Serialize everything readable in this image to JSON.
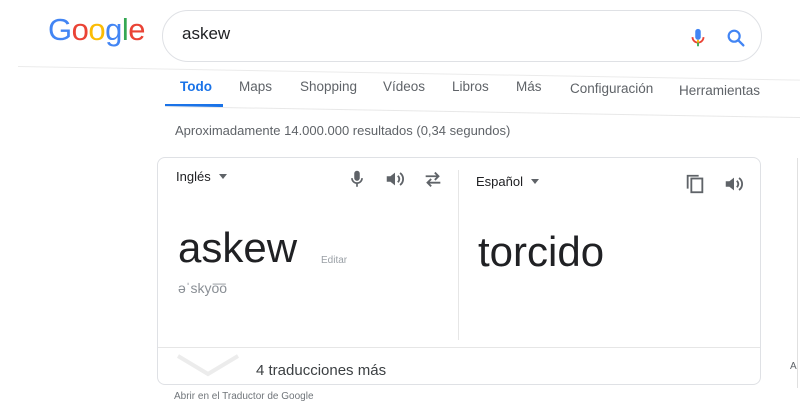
{
  "logo": {
    "letters": [
      "G",
      "o",
      "o",
      "g",
      "l",
      "e"
    ],
    "colors": [
      "#4285f4",
      "#ea4335",
      "#fbbc05",
      "#4285f4",
      "#34a853",
      "#ea4335"
    ]
  },
  "search": {
    "query": "askew"
  },
  "tabs": [
    {
      "label": "Todo",
      "active": true
    },
    {
      "label": "Maps"
    },
    {
      "label": "Shopping"
    },
    {
      "label": "Vídeos"
    },
    {
      "label": "Libros"
    },
    {
      "label": "Más"
    },
    {
      "label": "Configuración"
    },
    {
      "label": "Herramientas"
    }
  ],
  "results": {
    "count_text": "Aproximadamente 14.000.000 resultados (0,34 segundos)"
  },
  "translator": {
    "source_lang": "Inglés",
    "target_lang": "Español",
    "source_word": "askew",
    "edit_label": "Editar",
    "phonetic": "əˈskyo͞o",
    "target_word": "torcido",
    "more_translations": "4 traducciones más",
    "open_link": "Abrir en el Traductor de Google"
  },
  "right_edge": {
    "letter": "A"
  },
  "colors": {
    "accent": "#1a73e8",
    "icon_gray": "#5f6368",
    "border": "#dfe1e5"
  }
}
